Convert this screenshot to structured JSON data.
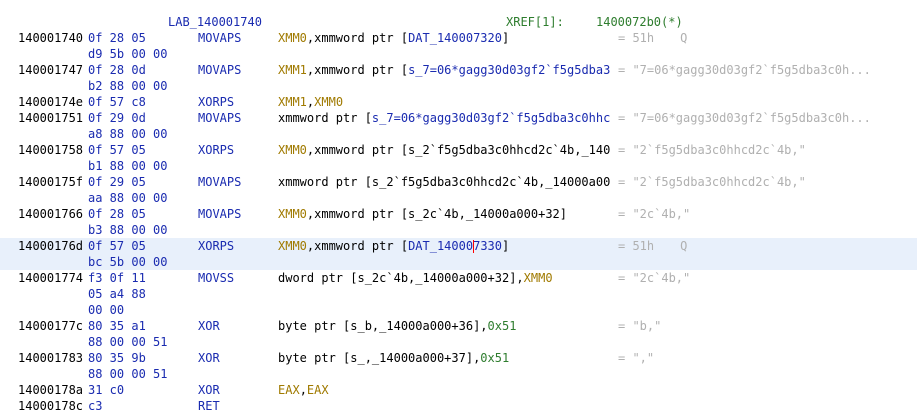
{
  "header": {
    "label": "LAB_140001740",
    "xref_label": "XREF[1]:",
    "xref_addr": "1400072b0(*)"
  },
  "rows": [
    {
      "addr": "140001740",
      "bytes": "0f 28 05",
      "mn": "MOVAPS",
      "ops": [
        {
          "t": "XMM0",
          "k": "reg"
        },
        {
          "t": ",xmmword ptr [",
          "k": "plain"
        },
        {
          "t": "DAT_140007320",
          "k": "lbl"
        },
        {
          "t": "]",
          "k": "plain"
        }
      ],
      "cmt": "= 51h",
      "q": "Q"
    },
    {
      "bytes": "d9 5b 00 00"
    },
    {
      "addr": "140001747",
      "bytes": "0f 28 0d",
      "mn": "MOVAPS",
      "ops": [
        {
          "t": "XMM1",
          "k": "reg"
        },
        {
          "t": ",xmmword ptr [",
          "k": "plain"
        },
        {
          "t": "s_7=06*gagg30d03gf2`f5g5dba3...",
          "k": "lbl"
        }
      ],
      "cmt": "= \"7=06*gagg30d03gf2`f5g5dba3c0h..."
    },
    {
      "bytes": "b2 88 00 00"
    },
    {
      "addr": "14000174e",
      "bytes": "0f 57 c8",
      "mn": "XORPS",
      "ops": [
        {
          "t": "XMM1",
          "k": "reg"
        },
        {
          "t": ",",
          "k": "plain"
        },
        {
          "t": "XMM0",
          "k": "reg"
        }
      ]
    },
    {
      "addr": "140001751",
      "bytes": "0f 29 0d",
      "mn": "MOVAPS",
      "ops": [
        {
          "t": "xmmword ptr [",
          "k": "plain"
        },
        {
          "t": "s_7=06*gagg30d03gf2`f5g5dba3c0hhc...",
          "k": "lbl"
        }
      ],
      "cmt": "= \"7=06*gagg30d03gf2`f5g5dba3c0h..."
    },
    {
      "bytes": "a8 88 00 00"
    },
    {
      "addr": "140001758",
      "bytes": "0f 57 05",
      "mn": "XORPS",
      "ops": [
        {
          "t": "XMM0",
          "k": "reg"
        },
        {
          "t": ",xmmword ptr [s_2`f5g5dba3c0hhcd2c`4b,_140...",
          "k": "plain"
        }
      ],
      "cmt": "= \"2`f5g5dba3c0hhcd2c`4b,\""
    },
    {
      "bytes": "b1 88 00 00"
    },
    {
      "addr": "14000175f",
      "bytes": "0f 29 05",
      "mn": "MOVAPS",
      "ops": [
        {
          "t": "xmmword ptr [s_2`f5g5dba3c0hhcd2c`4b,_14000a00...",
          "k": "plain"
        }
      ],
      "cmt": "= \"2`f5g5dba3c0hhcd2c`4b,\""
    },
    {
      "bytes": "aa 88 00 00"
    },
    {
      "addr": "140001766",
      "bytes": "0f 28 05",
      "mn": "MOVAPS",
      "ops": [
        {
          "t": "XMM0",
          "k": "reg"
        },
        {
          "t": ",xmmword ptr [s_2c`4b,_14000a000+32]",
          "k": "plain"
        }
      ],
      "cmt": "= \"2c`4b,\""
    },
    {
      "bytes": "b3 88 00 00"
    },
    {
      "addr": "14000176d",
      "bytes": "0f 57 05",
      "mn": "XORPS",
      "ops": [
        {
          "t": "XMM0",
          "k": "reg"
        },
        {
          "t": ",xmmword ptr [",
          "k": "plain"
        },
        {
          "t": "DAT_14000",
          "k": "lbl"
        },
        {
          "t": "CURSOR",
          "k": "cursor"
        },
        {
          "t": "7330",
          "k": "lbl"
        },
        {
          "t": "]",
          "k": "plain"
        }
      ],
      "cmt": "= 51h",
      "q": "Q",
      "highlight": true
    },
    {
      "bytes": "bc 5b 00 00",
      "highlight": true
    },
    {
      "addr": "140001774",
      "bytes": "f3 0f 11",
      "mn": "MOVSS",
      "ops": [
        {
          "t": "dword ptr [s_2c`4b,_14000a000+32],",
          "k": "plain"
        },
        {
          "t": "XMM0",
          "k": "reg"
        }
      ],
      "cmt": "= \"2c`4b,\""
    },
    {
      "bytes": "05 a4 88"
    },
    {
      "bytes": "00 00"
    },
    {
      "addr": "14000177c",
      "bytes": "80 35 a1",
      "mn": "XOR",
      "ops": [
        {
          "t": "byte ptr [s_b,_14000a000+36],",
          "k": "plain"
        },
        {
          "t": "0x51",
          "k": "num"
        }
      ],
      "cmt": "= \"b,\""
    },
    {
      "bytes": "88 00 00 51"
    },
    {
      "addr": "140001783",
      "bytes": "80 35 9b",
      "mn": "XOR",
      "ops": [
        {
          "t": "byte ptr [s_,_14000a000+37],",
          "k": "plain"
        },
        {
          "t": "0x51",
          "k": "num"
        }
      ],
      "cmt": "= \",\""
    },
    {
      "bytes": "88 00 00 51"
    },
    {
      "addr": "14000178a",
      "bytes": "31 c0",
      "mn": "XOR",
      "ops": [
        {
          "t": "EAX",
          "k": "reg"
        },
        {
          "t": ",",
          "k": "plain"
        },
        {
          "t": "EAX",
          "k": "reg"
        }
      ]
    },
    {
      "addr": "14000178c",
      "bytes": "c3",
      "mn": "RET"
    }
  ]
}
